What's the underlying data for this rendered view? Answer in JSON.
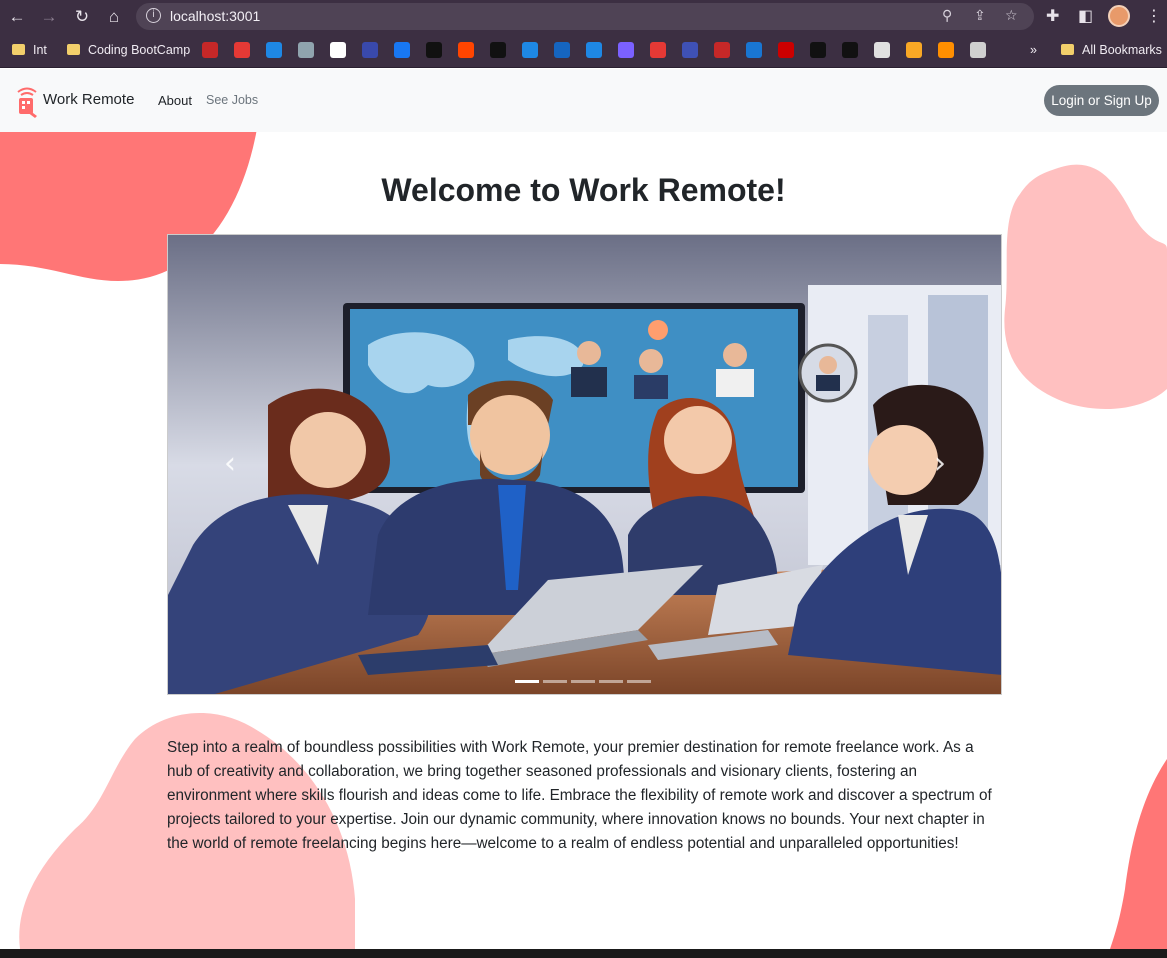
{
  "browser": {
    "url": "localhost:3001",
    "bookmarks": {
      "folders": [
        "Int",
        "Coding BootCamp"
      ],
      "overflow_label": "»",
      "all_bookmarks_label": "All Bookmarks"
    },
    "icons": [
      "back-arrow-icon",
      "forward-arrow-icon",
      "reload-icon",
      "home-icon",
      "site-info-icon",
      "zoom-icon",
      "share-icon",
      "star-icon",
      "extensions-icon",
      "side-panel-icon",
      "profile-avatar",
      "kebab-menu-icon"
    ]
  },
  "navbar": {
    "brand": "Work Remote",
    "links": [
      "About",
      "See Jobs"
    ],
    "login_label": "Login or Sign Up"
  },
  "hero": {
    "title": "Welcome to Work Remote!"
  },
  "carousel": {
    "prev_label": "‹",
    "next_label": "›",
    "slide_count": 5,
    "active_slide": 1
  },
  "intro": {
    "text": "Step into a realm of boundless possibilities with Work Remote, your premier destination for remote freelance work. As a hub of creativity and collaboration, we bring together seasoned professionals and visionary clients, fostering an environment where skills flourish and ideas come to life. Embrace the flexibility of remote work and discover a spectrum of projects tailored to your expertise. Join our dynamic community, where innovation knows no bounds. Your next chapter in the world of remote freelancing begins here—welcome to a realm of endless potential and unparalleled opportunities!"
  },
  "colors": {
    "blob_coral": "#ff7676",
    "blob_pink": "#ffc0c0",
    "navbar_bg": "#f8f9fa",
    "login_button": "#6c757d"
  }
}
